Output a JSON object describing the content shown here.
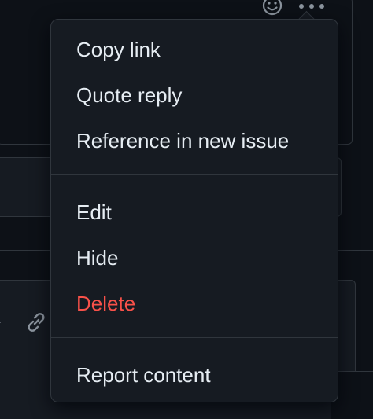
{
  "menu": {
    "items": [
      {
        "label": "Copy link"
      },
      {
        "label": "Quote reply"
      },
      {
        "label": "Reference in new issue"
      },
      {
        "label": "Edit"
      },
      {
        "label": "Hide"
      },
      {
        "label": "Delete",
        "style": "danger"
      },
      {
        "label": "Report content"
      }
    ]
  },
  "icons": {
    "add_reaction": "smiley-icon",
    "more_options": "kebab-horizontal-icon",
    "link": "link-icon"
  },
  "colors": {
    "background": "#0d1117",
    "menu_background": "#161b22",
    "border": "#30363d",
    "text": "#e6edf3",
    "danger": "#f85149",
    "muted_icon": "#8b949e"
  }
}
